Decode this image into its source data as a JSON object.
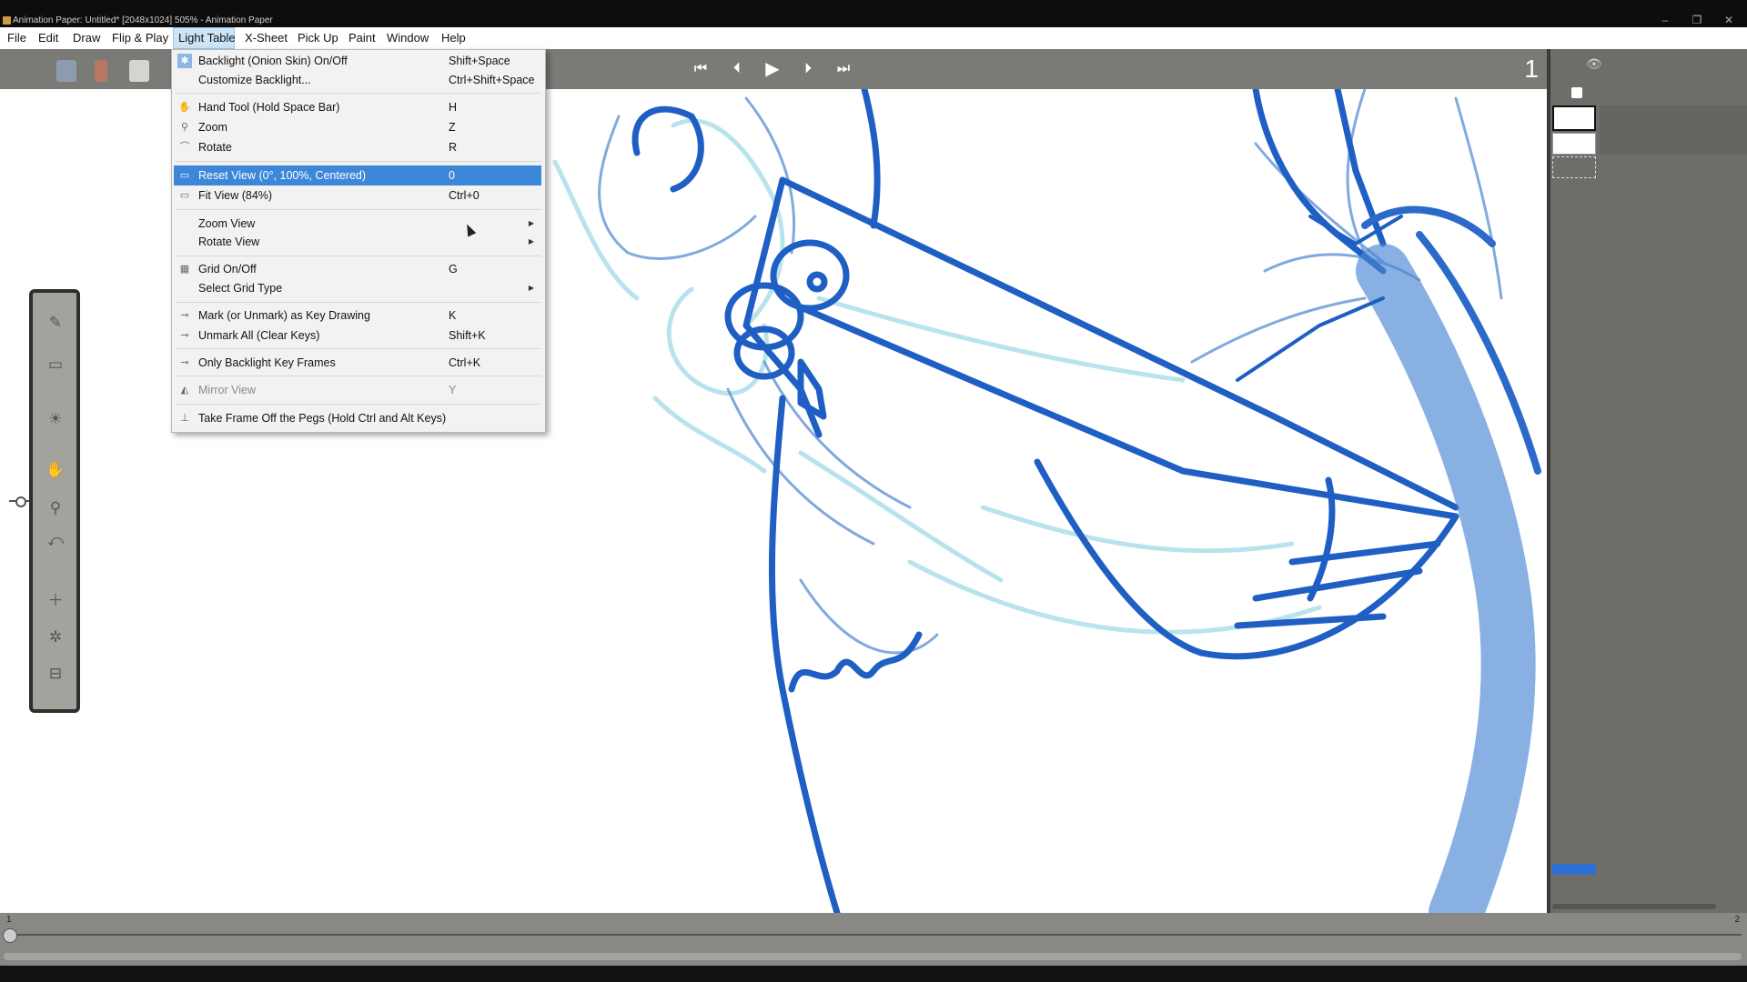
{
  "window": {
    "title": "Animation Paper: Untitled* [2048x1024] 505% - Animation Paper",
    "controls": {
      "minimize": "–",
      "maximize": "❐",
      "close": "✕"
    }
  },
  "menubar": {
    "items": [
      "File",
      "Edit",
      "Draw",
      "Flip & Play",
      "Light Table",
      "X-Sheet",
      "Pick Up",
      "Paint",
      "Window",
      "Help"
    ],
    "active": "Light Table"
  },
  "playback": {
    "first_icon": "skip-to-start-icon",
    "prev_icon": "previous-frame-icon",
    "play_icon": "play-icon",
    "next_icon": "next-frame-icon",
    "last_icon": "skip-to-end-icon",
    "current_frame": "1"
  },
  "light_table_menu": {
    "items": [
      {
        "label": "Backlight (Onion Skin) On/Off",
        "shortcut": "Shift+Space",
        "icon": "backlight-icon"
      },
      {
        "label": "Customize Backlight...",
        "shortcut": "Ctrl+Shift+Space",
        "icon": ""
      },
      {
        "label": "Hand Tool (Hold Space Bar)",
        "shortcut": "H",
        "icon": "hand-icon"
      },
      {
        "label": "Zoom",
        "shortcut": "Z",
        "icon": "zoom-icon"
      },
      {
        "label": "Rotate",
        "shortcut": "R",
        "icon": "rotate-icon"
      },
      {
        "label": "Reset View (0°, 100%, Centered)",
        "shortcut": "0",
        "icon": "reset-view-icon"
      },
      {
        "label": "Fit View (84%)",
        "shortcut": "Ctrl+0",
        "icon": "fit-view-icon"
      },
      {
        "label": "Zoom View",
        "shortcut": "",
        "icon": ""
      },
      {
        "label": "Rotate View",
        "shortcut": "",
        "icon": ""
      },
      {
        "label": "Grid On/Off",
        "shortcut": "G",
        "icon": "grid-icon"
      },
      {
        "label": "Select Grid Type",
        "shortcut": "",
        "icon": ""
      },
      {
        "label": "Mark (or Unmark) as Key Drawing",
        "shortcut": "K",
        "icon": "key-icon"
      },
      {
        "label": "Unmark All (Clear Keys)",
        "shortcut": "Shift+K",
        "icon": "unmark-icon"
      },
      {
        "label": "Only Backlight Key Frames",
        "shortcut": "Ctrl+K",
        "icon": "key-frames-icon"
      },
      {
        "label": "Mirror View",
        "shortcut": "Y",
        "icon": "mirror-icon"
      },
      {
        "label": "Take Frame Off the Pegs (Hold Ctrl and Alt Keys)",
        "shortcut": "",
        "icon": "pegs-icon"
      }
    ],
    "highlighted_index": 5
  },
  "timeline": {
    "start_frame": "1",
    "end_frame": "2"
  },
  "colors": {
    "menu_highlight": "#3d87d9",
    "stroke_dark": "#1f5fc4",
    "stroke_mid": "#5b8fd6",
    "stroke_light": "#9fd6e4",
    "panel": "#6f6d69"
  }
}
